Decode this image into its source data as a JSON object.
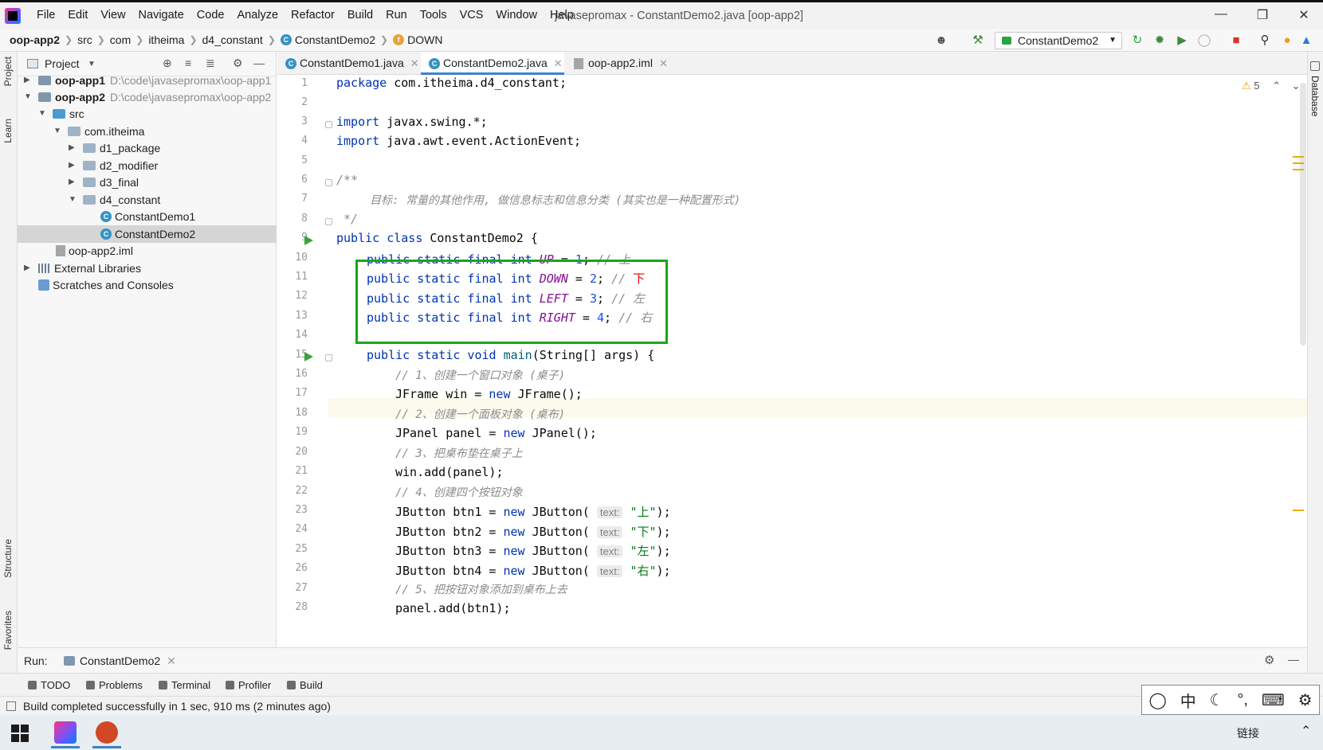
{
  "window": {
    "title": "javasepromax - ConstantDemo2.java [oop-app2]",
    "menu": [
      "File",
      "Edit",
      "View",
      "Navigate",
      "Code",
      "Analyze",
      "Refactor",
      "Build",
      "Run",
      "Tools",
      "VCS",
      "Window",
      "Help"
    ]
  },
  "breadcrumbs": [
    "oop-app2",
    "src",
    "com",
    "itheima",
    "d4_constant",
    "ConstantDemo2",
    "DOWN"
  ],
  "run_config": "ConstantDemo2",
  "side_tabs": {
    "left_top": [
      "Project",
      "Learn"
    ],
    "left_bottom": [
      "Structure",
      "Favorites"
    ],
    "right": [
      "Database"
    ]
  },
  "project": {
    "title": "Project",
    "tree": [
      {
        "label": "oop-app1",
        "path": "D:\\code\\javasepromax\\oop-app1",
        "bold": true
      },
      {
        "label": "oop-app2",
        "path": "D:\\code\\javasepromax\\oop-app2",
        "bold": true
      },
      {
        "label": "src"
      },
      {
        "label": "com.itheima"
      },
      {
        "label": "d1_package"
      },
      {
        "label": "d2_modifier"
      },
      {
        "label": "d3_final"
      },
      {
        "label": "d4_constant"
      },
      {
        "label": "ConstantDemo1"
      },
      {
        "label": "ConstantDemo2"
      },
      {
        "label": "oop-app2.iml"
      },
      {
        "label": "External Libraries"
      },
      {
        "label": "Scratches and Consoles"
      }
    ]
  },
  "tabs": [
    "ConstantDemo1.java",
    "ConstantDemo2.java",
    "oop-app2.iml"
  ],
  "warnings_count": "5",
  "code": {
    "line_numbers": [
      "1",
      "2",
      "3",
      "4",
      "5",
      "6",
      "7",
      "8",
      "9",
      "10",
      "11",
      "12",
      "13",
      "14",
      "15",
      "16",
      "17",
      "18",
      "19",
      "20",
      "21",
      "22",
      "23",
      "24",
      "25",
      "26",
      "27",
      "28"
    ],
    "l1_kw": "package",
    "l1_rest": " com.itheima.d4_constant;",
    "l3_kw": "import",
    "l3_rest": " javax.swing.*;",
    "l4_kw": "import",
    "l4_rest": " java.awt.event.ActionEvent;",
    "l6": "/**",
    "l7": "     目标: 常量的其他作用, 做信息标志和信息分类 (其实也是一种配置形式)",
    "l8": " */",
    "l9_kw": "public class",
    "l9_rest": " ConstantDemo2 {",
    "psfi": "public static final int",
    "c_up": "UP",
    "v_up": "1",
    "cm_up": "// 上",
    "c_down": "DOWN",
    "v_down": "2",
    "cm_down": "// ",
    "cm_down_char": "下",
    "c_left": "LEFT",
    "v_left": "3",
    "cm_left": "// 左",
    "c_right": "RIGHT",
    "v_right": "4",
    "cm_right": "// 右",
    "l15_kw": "public static void",
    "l15_fn": "main",
    "l15_rest": "(String[] args) {",
    "l16": "// 1、创建一个窗口对象 (桌子)",
    "l17_a": "JFrame win = ",
    "l17_kw": "new",
    "l17_b": " JFrame();",
    "l18": "// 2、创建一个面板对象 (桌布)",
    "l19_a": "JPanel panel = ",
    "l19_kw": "new",
    "l19_b": " JPanel();",
    "l20": "// 3、把桌布垫在桌子上",
    "l21": "win.add(panel);",
    "l22": "// 4、创建四个按钮对象",
    "btn_new": "new",
    "btn_ctor": " JButton(",
    "hint": "text:",
    "btn1": "JButton btn1 = ",
    "btn1_str": "\"上\"",
    "btn2": "JButton btn2 = ",
    "btn2_str": "\"下\"",
    "btn3": "JButton btn3 = ",
    "btn3_str": "\"左\"",
    "btn4": "JButton btn4 = ",
    "btn4_str": "\"右\"",
    "btn_end": ");",
    "l27": "// 5、把按钮对象添加到桌布上去",
    "l28": "panel.add(btn1);"
  },
  "run_bar": {
    "label": "Run:",
    "tab": "ConstantDemo2"
  },
  "tool_windows": [
    "TODO",
    "Problems",
    "Terminal",
    "Profiler",
    "Build"
  ],
  "status": "Build completed successfully in 1 sec, 910 ms (2 minutes ago)",
  "ime": [
    "中"
  ],
  "taskbar": {
    "lang": "链接"
  }
}
